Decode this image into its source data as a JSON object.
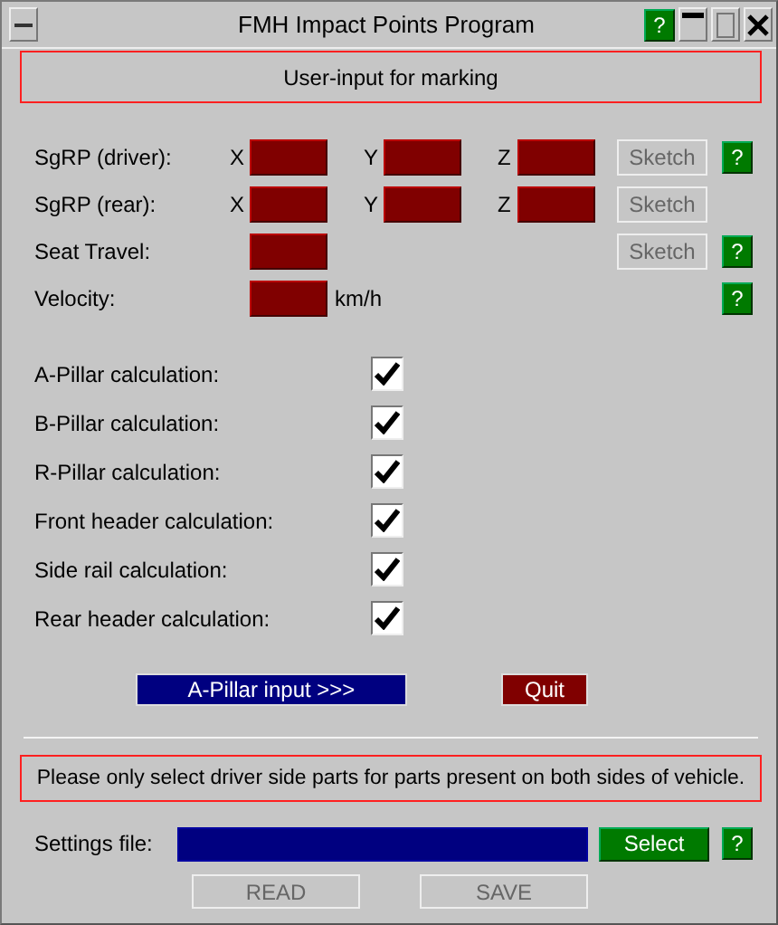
{
  "window": {
    "title": "FMH Impact Points Program",
    "help": "?"
  },
  "header_banner": "User-input for marking",
  "inputs": [
    {
      "label": "SgRP (driver):",
      "axes": [
        "X",
        "Y",
        "Z"
      ],
      "sketch": {
        "label": "Sketch",
        "disabled": true
      },
      "help": "?"
    },
    {
      "label": "SgRP (rear):",
      "axes": [
        "X",
        "Y",
        "Z"
      ],
      "sketch": {
        "label": "Sketch",
        "disabled": true
      }
    },
    {
      "label": "Seat Travel:",
      "sketch": {
        "label": "Sketch",
        "disabled": true
      },
      "help": "?"
    },
    {
      "label": "Velocity:",
      "unit": "km/h",
      "help": "?"
    }
  ],
  "calculations": [
    {
      "label": "A-Pillar calculation:",
      "checked": true
    },
    {
      "label": "B-Pillar calculation:",
      "checked": true
    },
    {
      "label": "R-Pillar calculation:",
      "checked": true
    },
    {
      "label": "Front header calculation:",
      "checked": true
    },
    {
      "label": "Side rail calculation:",
      "checked": true
    },
    {
      "label": "Rear header calculation:",
      "checked": true
    }
  ],
  "actions": [
    {
      "label": "A-Pillar input >>>",
      "kind": "primary"
    },
    {
      "label": "Quit",
      "kind": "danger"
    }
  ],
  "notice": "Please only select driver side parts for parts present on both sides of vehicle.",
  "settings": {
    "label": "Settings file:",
    "select": "Select",
    "help": "?"
  },
  "file_buttons": [
    {
      "label": "READ",
      "disabled": true
    },
    {
      "label": "SAVE",
      "disabled": true
    }
  ]
}
